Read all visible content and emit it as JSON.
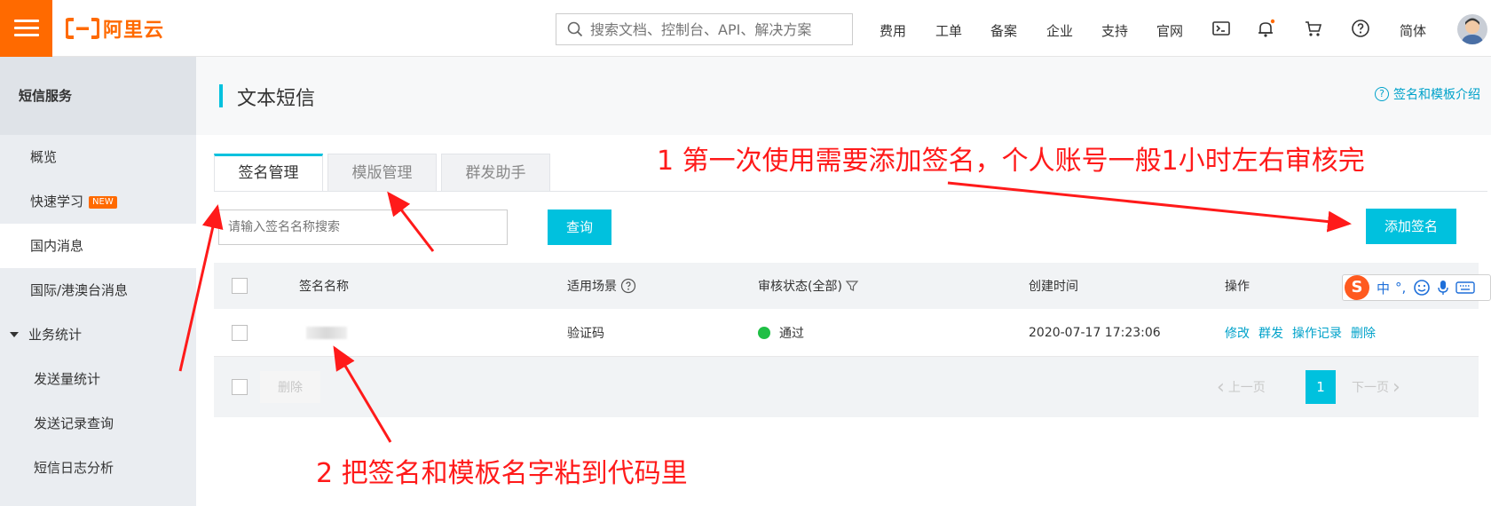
{
  "header": {
    "brand": "阿里云",
    "search_placeholder": "搜索文档、控制台、API、解决方案",
    "nav": [
      "费用",
      "工单",
      "备案",
      "企业",
      "支持",
      "官网"
    ],
    "lang": "简体"
  },
  "sidebar": {
    "title": "短信服务",
    "items": [
      {
        "label": "概览"
      },
      {
        "label": "快速学习",
        "badge": "NEW"
      },
      {
        "label": "国内消息"
      },
      {
        "label": "国际/港澳台消息"
      },
      {
        "label": "业务统计"
      },
      {
        "label": "发送量统计"
      },
      {
        "label": "发送记录查询"
      },
      {
        "label": "短信日志分析"
      }
    ]
  },
  "page": {
    "title": "文本短信",
    "help_link": "签名和模板介绍",
    "tabs": [
      "签名管理",
      "模版管理",
      "群发助手"
    ],
    "search_placeholder": "请输入签名名称搜索",
    "query_button": "查询",
    "add_button": "添加签名"
  },
  "table": {
    "columns": [
      "签名名称",
      "适用场景",
      "审核状态(全部)",
      "创建时间",
      "操作"
    ],
    "rows": [
      {
        "name": "",
        "scene": "验证码",
        "status": "通过",
        "created": "2020-07-17 17:23:06",
        "actions": [
          "修改",
          "群发",
          "操作记录",
          "删除"
        ]
      }
    ],
    "delete_button": "删除",
    "pager": {
      "prev": "上一页",
      "page": "1",
      "next": "下一页"
    }
  },
  "annotations": {
    "note1": "1 第一次使用需要添加签名，个人账号一般1小时左右审核完",
    "note2": "2 把签名和模板名字粘到代码里"
  },
  "ime": {
    "logo": "S",
    "mode": "中",
    "punct": "°,"
  },
  "colors": {
    "accent": "#00c1de",
    "brand": "#ff6a00",
    "annotation": "#ff1a1a",
    "success": "#1fbf45"
  }
}
